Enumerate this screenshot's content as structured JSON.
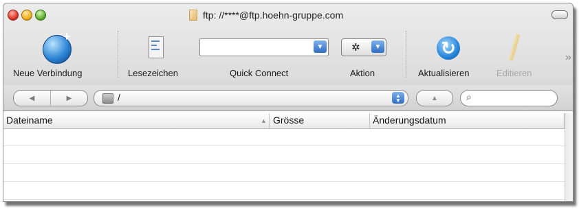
{
  "window": {
    "title": "ftp: //****@ftp.hoehn-gruppe.com"
  },
  "toolbar": {
    "new_connection_label": "Neue Verbindung",
    "bookmarks_label": "Lesezeichen",
    "quick_connect_label": "Quick Connect",
    "quick_connect_value": "",
    "action_label": "Aktion",
    "refresh_label": "Aktualisieren",
    "edit_label": "Editieren",
    "edit_enabled": false,
    "icons": {
      "new_connection": "globe-plus-icon",
      "bookmarks": "bookmark-list-icon",
      "action": "gear-icon",
      "refresh": "refresh-icon",
      "edit": "pencil-icon",
      "overflow": "double-chevron-icon"
    }
  },
  "navigation": {
    "back_glyph": "◀",
    "forward_glyph": "▶",
    "path": "/",
    "up_glyph": "▲",
    "search_glyph": "⌕",
    "search_value": ""
  },
  "file_table": {
    "columns": [
      "Dateiname",
      "Grösse",
      "Änderungsdatum"
    ],
    "sort_glyph": "▲",
    "rows": []
  },
  "colors": {
    "accent_blue": "#2f6ec3",
    "window_chrome": "#dcdcdc"
  }
}
